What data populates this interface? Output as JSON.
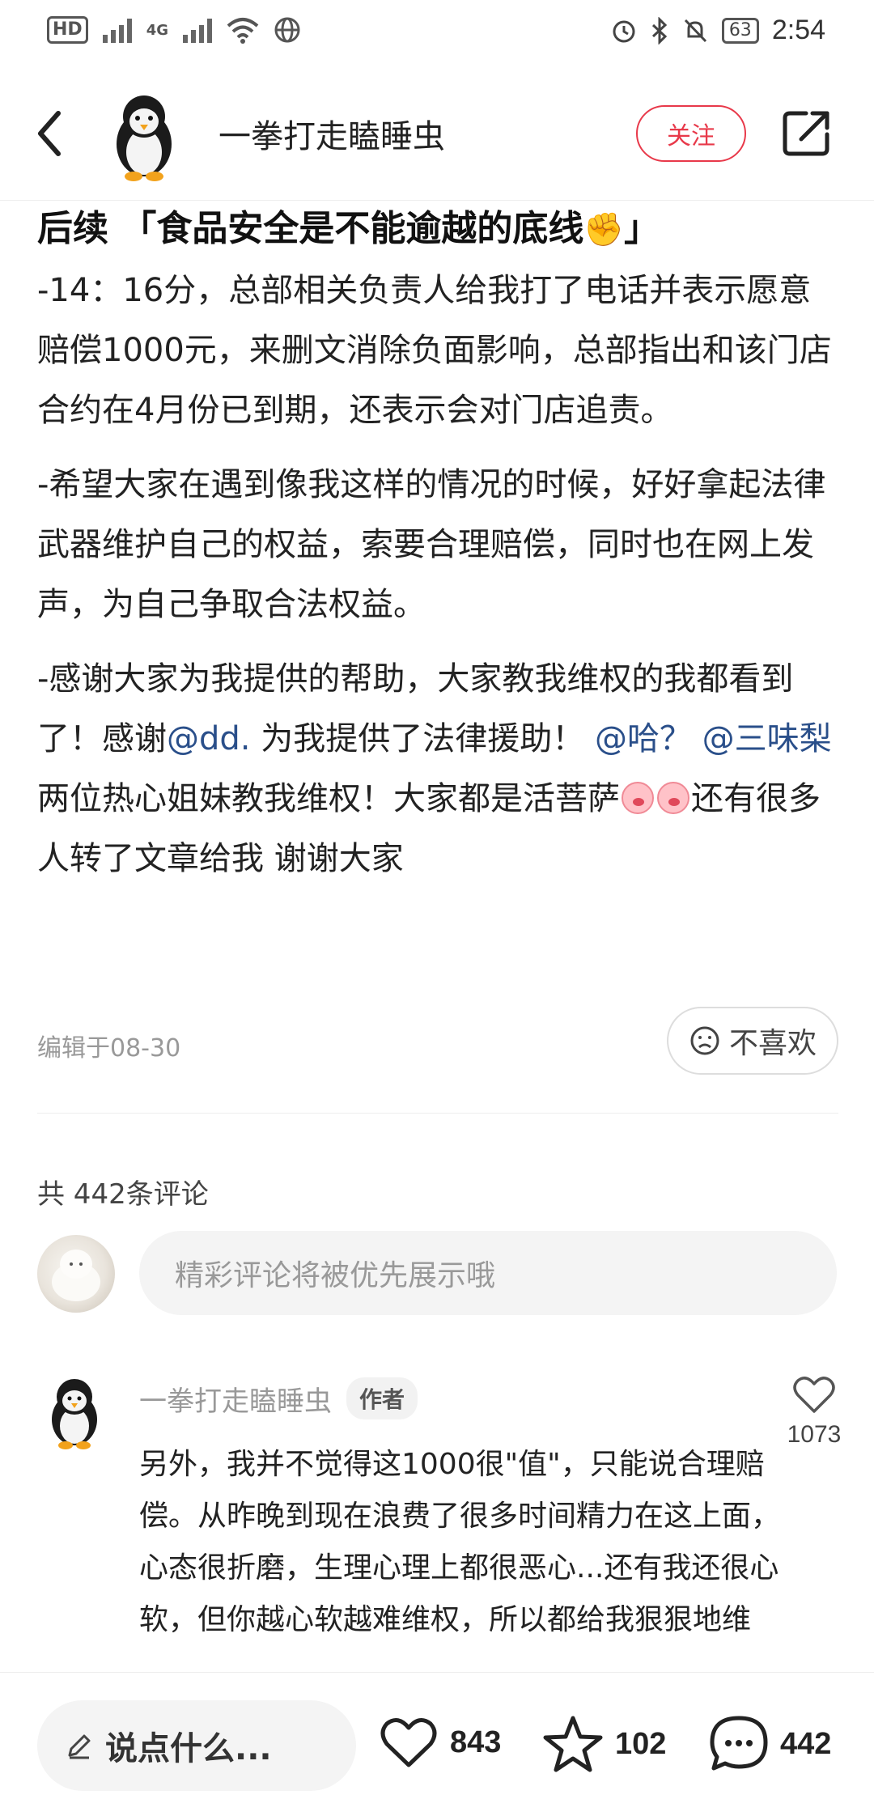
{
  "status_bar": {
    "time": "2:54",
    "battery": "63",
    "hd_label": "HD",
    "network": "4G"
  },
  "header": {
    "author_name": "一拳打走瞌睡虫",
    "follow_label": "关注"
  },
  "article": {
    "title": "后续 「食品安全是不能逾越的底线",
    "title_end": "」",
    "para1": "-14：16分，总部相关负责人给我打了电话并表示愿意赔偿1000元，来删文消除负面影响，总部指出和该门店合约在4月份已到期，还表示会对门店追责。",
    "para2": "-希望大家在遇到像我这样的情况的时候，好好拿起法律武器维护自己的权益，索要合理赔偿，同时也在网上发声，为自己争取合法权益。",
    "para3_a": "-感谢大家为我提供的帮助，大家教我维权的我都看到了！感谢",
    "mention1": "@dd.",
    "para3_b": " 为我提供了法律援助！ ",
    "mention2": "@哈？",
    "para3_c": " ",
    "mention3": "@三味梨",
    "para3_d": " 两位热心姐妹教我维权！大家都是活菩萨",
    "para3_e": "还有很多人转了文章给我 谢谢大家",
    "edit_date": "编辑于08-30",
    "dislike_label": "不喜欢"
  },
  "comments": {
    "count_label": "共 442条评论",
    "input_placeholder": "精彩评论将被优先展示哦",
    "items": [
      {
        "name": "一拳打走瞌睡虫",
        "badge": "作者",
        "likes": "1073",
        "text": "另外，我并不觉得这1000很\"值\"，只能说合理赔偿。从昨晚到现在浪费了很多时间精力在这上面，心态很折磨，生理心理上都很恶心...还有我还很心软，但你越心软越难维权，所以都给我狠狠地维"
      }
    ]
  },
  "bottom_bar": {
    "say_placeholder": "说点什么...",
    "likes": "843",
    "favorites": "102",
    "comments": "442"
  },
  "colors": {
    "accent": "#e8394a",
    "mention": "#2a4f8a"
  }
}
